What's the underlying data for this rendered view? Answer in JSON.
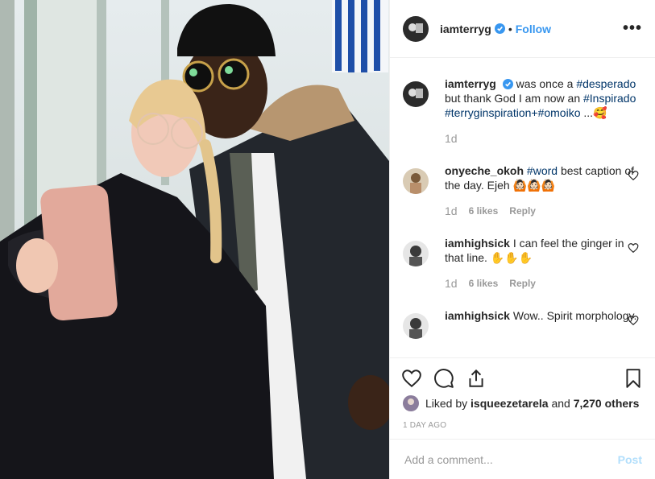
{
  "post": {
    "username": "iamterryg",
    "follow_label": "Follow",
    "separator": "•",
    "more_label": "•••"
  },
  "caption": {
    "username": "iamterryg",
    "text_1": "was once a",
    "tag_1": "#desperado",
    "text_2": "but thank God I am now an",
    "tag_2": "#Inspirado",
    "tag_3": "#terryginspiration+",
    "tag_4": "#omoiko",
    "text_3": "...🥰",
    "age": "1d"
  },
  "comments": [
    {
      "username": "onyeche_okoh",
      "tag": "#word",
      "text": "best caption of the day. Ejeh 🙆🏻🙆🏻🙆🏻",
      "age": "1d",
      "likes": "6 likes",
      "reply": "Reply"
    },
    {
      "username": "iamhighsick",
      "text": "I can feel the ginger in that line. ✋✋✋",
      "age": "1d",
      "likes": "6 likes",
      "reply": "Reply"
    },
    {
      "username": "iamhighsick",
      "text": "Wow.. Spirit morphology."
    }
  ],
  "likes": {
    "prefix": "Liked by",
    "user": "isqueezetarela",
    "connector": "and",
    "count": "7,270 others"
  },
  "date": "1 DAY AGO",
  "add_comment": {
    "placeholder": "Add a comment...",
    "post_label": "Post"
  },
  "icons": [
    "heart-icon",
    "comment-icon",
    "share-icon",
    "bookmark-icon",
    "verified-badge-icon",
    "more-options-icon"
  ],
  "colors": {
    "link": "#3897f0",
    "hashtag": "#003569",
    "muted": "#999999",
    "post_disabled": "#b2dffc"
  }
}
